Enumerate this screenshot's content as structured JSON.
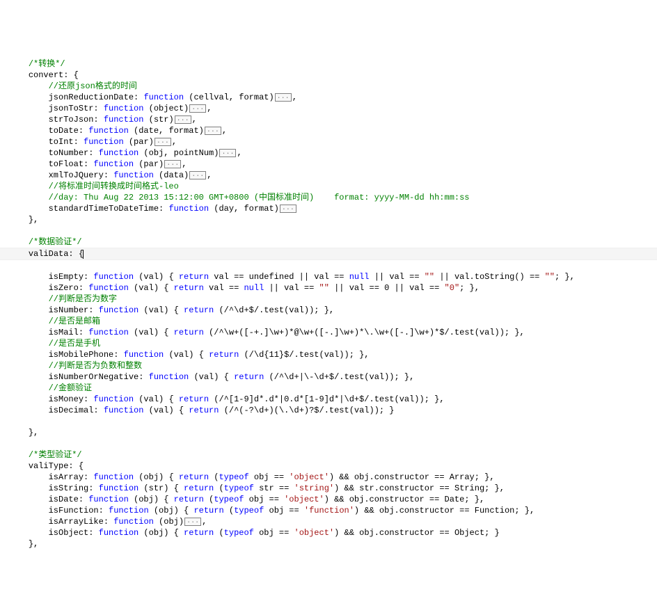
{
  "fold": "...",
  "r01": "/*转换*/",
  "r02": "convert: {",
  "r03": "//还原json格式的时间",
  "r04a": "jsonReductionDate: ",
  "r04b": "function",
  "r04c": " (cellval, format)",
  "r04d": ",",
  "r05a": "jsonToStr: ",
  "r05b": "function",
  "r05c": " (object)",
  "r05d": ",",
  "r06a": "strToJson: ",
  "r06b": "function",
  "r06c": " (str)",
  "r06d": ",",
  "r07a": "toDate: ",
  "r07b": "function",
  "r07c": " (date, format)",
  "r07d": ",",
  "r08a": "toInt: ",
  "r08b": "function",
  "r08c": " (par)",
  "r08d": ",",
  "r09a": "toNumber: ",
  "r09b": "function",
  "r09c": " (obj, pointNum)",
  "r09d": ",",
  "r10a": "toFloat: ",
  "r10b": "function",
  "r10c": " (par)",
  "r10d": ",",
  "r11a": "xmlToJQuery: ",
  "r11b": "function",
  "r11c": " (data)",
  "r11d": ",",
  "r12": "//将标准时间转换成时间格式-leo",
  "r13": "//day: Thu Aug 22 2013 15:12:00 GMT+0800 (中国标准时间)    format: yyyy-MM-dd hh:mm:ss",
  "r14a": "standardTimeToDateTime: ",
  "r14b": "function",
  "r14c": " (day, format)",
  "r15": "},",
  "r16": "/*数据验证*/",
  "r17": "valiData: {",
  "r18a": "isEmpty: ",
  "r18b": "function",
  "r18c": " (val) { ",
  "r18d": "return",
  "r18e": " val == undefined || val == ",
  "r18f": "null",
  "r18g": " || val == ",
  "r18h": "\"\"",
  "r18i": " || val.toString() == ",
  "r18j": "\"\"",
  "r18k": "; },",
  "r19a": "isZero: ",
  "r19b": "function",
  "r19c": " (val) { ",
  "r19d": "return",
  "r19e": " val == ",
  "r19f": "null",
  "r19g": " || val == ",
  "r19h": "\"\"",
  "r19i": " || val == 0 || val == ",
  "r19j": "\"0\"",
  "r19k": "; },",
  "r20": "//判断是否为数字",
  "r21a": "isNumber: ",
  "r21b": "function",
  "r21c": " (val) { ",
  "r21d": "return",
  "r21e": " (/^\\d+$/.test(val)); },",
  "r22": "//是否是邮箱",
  "r23a": "isMail: ",
  "r23b": "function",
  "r23c": " (val) { ",
  "r23d": "return",
  "r23e": " (/^\\w+([-+.]\\w+)*@\\w+([-.]\\w+)*\\.\\w+([-.]\\w+)*$/.test(val)); },",
  "r24": "//是否是手机",
  "r25a": "isMobilePhone: ",
  "r25b": "function",
  "r25c": " (val) { ",
  "r25d": "return",
  "r25e": " (/\\d{11}$/.test(val)); },",
  "r26": "//判断是否为负数和整数",
  "r27a": "isNumberOrNegative: ",
  "r27b": "function",
  "r27c": " (val) { ",
  "r27d": "return",
  "r27e": " (/^\\d+|\\-\\d+$/.test(val)); },",
  "r28": "//金额验证",
  "r29a": "isMoney: ",
  "r29b": "function",
  "r29c": " (val) { ",
  "r29d": "return",
  "r29e": " (/^[1-9]d*.d*|0.d*[1-9]d*|\\d+$/.test(val)); },",
  "r30a": "isDecimal: ",
  "r30b": "function",
  "r30c": " (val) { ",
  "r30d": "return",
  "r30e": " (/^(-?\\d+)(\\.\\d+)?$/.test(val)); }",
  "r31": "},",
  "r32": "/*类型验证*/",
  "r33": "valiType: {",
  "r34a": "isArray: ",
  "r34b": "function",
  "r34c": " (obj) { ",
  "r34d": "return",
  "r34e": " (",
  "r34f": "typeof",
  "r34g": " obj == ",
  "r34h": "'object'",
  "r34i": ") && obj.constructor == Array; },",
  "r35a": "isString: ",
  "r35b": "function",
  "r35c": " (str) { ",
  "r35d": "return",
  "r35e": " (",
  "r35f": "typeof",
  "r35g": " str == ",
  "r35h": "'string'",
  "r35i": ") && str.constructor == String; },",
  "r36a": "isDate: ",
  "r36b": "function",
  "r36c": " (obj) { ",
  "r36d": "return",
  "r36e": " (",
  "r36f": "typeof",
  "r36g": " obj == ",
  "r36h": "'object'",
  "r36i": ") && obj.constructor == Date; },",
  "r37a": "isFunction: ",
  "r37b": "function",
  "r37c": " (obj) { ",
  "r37d": "return",
  "r37e": " (",
  "r37f": "typeof",
  "r37g": " obj == ",
  "r37h": "'function'",
  "r37i": ") && obj.constructor == Function; },",
  "r38a": "isArrayLike: ",
  "r38b": "function",
  "r38c": " (obj)",
  "r38d": ",",
  "r39a": "isObject: ",
  "r39b": "function",
  "r39c": " (obj) { ",
  "r39d": "return",
  "r39e": " (",
  "r39f": "typeof",
  "r39g": " obj == ",
  "r39h": "'object'",
  "r39i": ") && obj.constructor == Object; }",
  "r40": "},"
}
